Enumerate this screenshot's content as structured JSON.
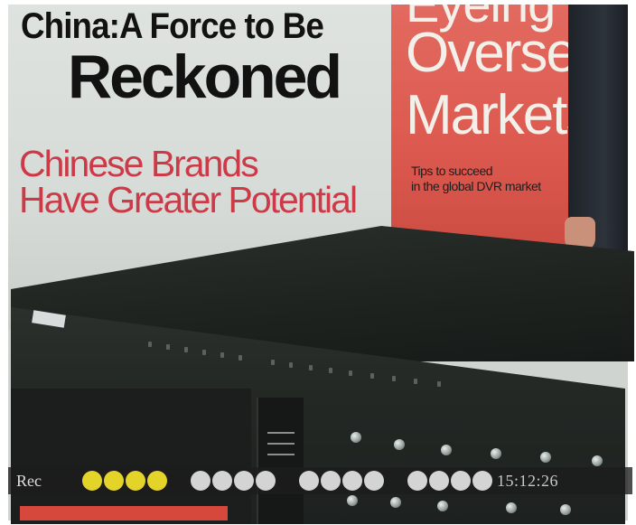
{
  "poster": {
    "headline_line1": "China:A Force to Be",
    "headline_line2": "Reckoned",
    "subhead_line1": "Chinese Brands",
    "subhead_line2": "Have Greater Potential",
    "right_partial_top": "Eyeing",
    "right_title_1": "Overseas",
    "right_title_2": "Markets",
    "tips_line1": "Tips to succeed",
    "tips_line2": "in the global DVR market"
  },
  "osd": {
    "rec_label": "Rec",
    "time": "15:12:26",
    "channel_groups": [
      [
        "active",
        "active",
        "active",
        "active"
      ],
      [
        "idle",
        "idle",
        "idle",
        "idle"
      ],
      [
        "idle",
        "idle",
        "idle",
        "idle"
      ],
      [
        "idle",
        "idle",
        "idle",
        "idle"
      ]
    ],
    "colors": {
      "active": "#e4d42a",
      "idle": "#d4d4d4"
    }
  }
}
